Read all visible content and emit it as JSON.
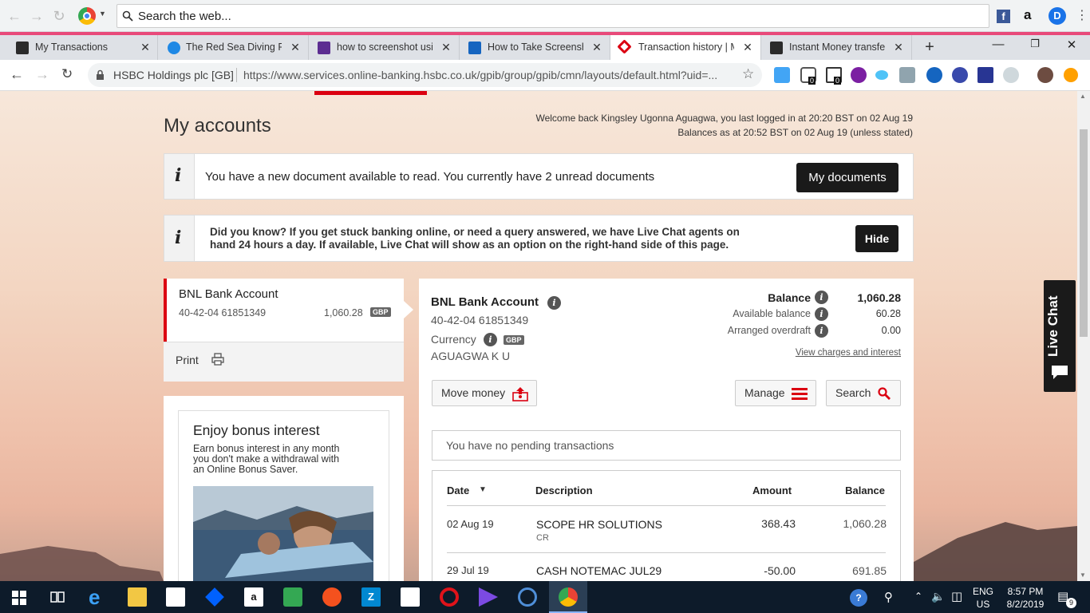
{
  "browser": {
    "search_placeholder": "Search the web...",
    "tabs": [
      {
        "title": "My Transactions",
        "icon_color": "#2b2b2b",
        "active": false
      },
      {
        "title": "The Red Sea Diving Res",
        "icon_color": "#1e88e5",
        "active": false
      },
      {
        "title": "how to screenshot usin",
        "icon_color": "#5c2d91",
        "active": false
      },
      {
        "title": "How to Take Screensho",
        "icon_color": "#1565c0",
        "active": false
      },
      {
        "title": "Transaction history | My",
        "icon_color": "#db0011",
        "active": true
      },
      {
        "title": "Instant Money transfer",
        "icon_color": "#2b2b2b",
        "active": false
      }
    ],
    "site_label": "HSBC Holdings plc [GB]",
    "url": "https://www.services.online-banking.hsbc.co.uk/gpib/group/gpib/cmn/layouts/default.html?uid=...",
    "ext_badge_1": "0",
    "ext_badge_2": "0"
  },
  "page": {
    "title": "My accounts",
    "welcome_line1": "Welcome back Kingsley Ugonna Aguagwa, you last logged in at 20:20 BST on 02 Aug 19",
    "welcome_line2": "Balances as at 20:52 BST on 02 Aug 19 (unless stated)",
    "notice1": {
      "text": "You have a new document available to read. You currently have 2 unread documents",
      "button": "My documents"
    },
    "notice2": {
      "line1": "Did you know? If you get stuck banking online, or need a query answered, we have Live Chat agents on",
      "line2": "hand 24 hours a day. If available, Live Chat will show as an option on the right-hand side of this page.",
      "button": "Hide"
    },
    "account_card": {
      "name": "BNL Bank Account",
      "number": "40-42-04 61851349",
      "balance": "1,060.28",
      "currency": "GBP"
    },
    "print_label": "Print",
    "promo": {
      "title": "Enjoy bonus interest",
      "line1": "Earn bonus interest in any month",
      "line2": "you don't make a withdrawal with",
      "line3": "an Online Bonus Saver."
    },
    "detail": {
      "name": "BNL Bank Account",
      "number": "40-42-04 61851349",
      "currency_label": "Currency",
      "currency": "GBP",
      "holder": "AGUAGWA K U",
      "balance_label": "Balance",
      "balance": "1,060.28",
      "available_label": "Available balance",
      "available": "60.28",
      "overdraft_label": "Arranged overdraft",
      "overdraft": "0.00",
      "charges_link": "View charges and interest",
      "move_money": "Move money",
      "manage": "Manage",
      "search": "Search",
      "pending": "You have no pending transactions"
    },
    "transactions": {
      "headers": {
        "date": "Date",
        "description": "Description",
        "amount": "Amount",
        "balance": "Balance"
      },
      "rows": [
        {
          "date": "02 Aug 19",
          "description": "SCOPE HR SOLUTIONS",
          "type": "CR",
          "amount": "368.43",
          "balance": "1,060.28"
        },
        {
          "date": "29 Jul 19",
          "description": "CASH NOTEMAC JUL29",
          "type": "",
          "amount": "-50.00",
          "balance": "691.85"
        }
      ]
    },
    "live_chat": "Live Chat"
  },
  "taskbar": {
    "lang1": "ENG",
    "lang2": "US",
    "time": "8:57 PM",
    "date": "8/2/2019",
    "notif_count": "9"
  }
}
